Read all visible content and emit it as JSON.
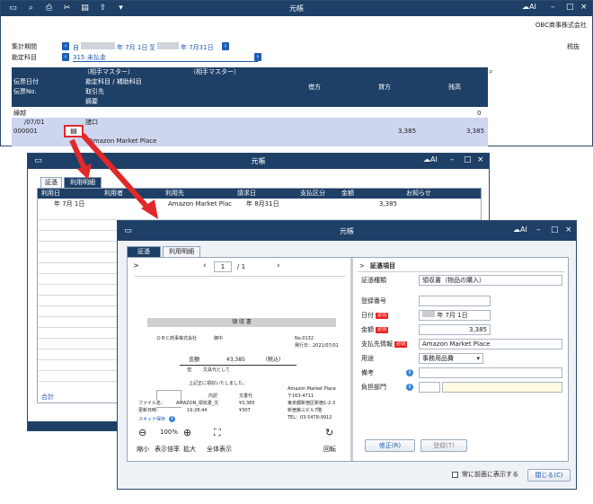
{
  "w1": {
    "title": "元帳",
    "company": "OBC商事株式会社",
    "period_label": "集計期間",
    "from": "自",
    "from_date": "年  7月 1日",
    "to": "至",
    "to_date": "年  7月31日",
    "account_label": "勘定科目",
    "account_code": "315",
    "account_name": "未払金",
    "tax": "税抜",
    "h_partner1": "（相手マスター）",
    "h_partner2": "（相手マスター）",
    "h_date": "伝票日付",
    "h_sub": "勘定科目 / 補助科目",
    "h_no": "伝票No.",
    "h_client": "取引先",
    "h_memo": "摘要",
    "h_debit": "借方",
    "h_credit": "貸方",
    "h_balance": "残高",
    "carry_label": "繰越",
    "carry_balance": "0",
    "r_date": "/07/01",
    "r_sub": "諸口",
    "r_no": "000001",
    "r_credit": "3,385",
    "r_balance": "3,385",
    "r_memo": "Amazon Market Place"
  },
  "w2": {
    "title": "元帳",
    "tab1": "証憑",
    "tab2": "利用明細",
    "cols": [
      "利用日",
      "利用者",
      "利用先",
      "請求日",
      "支払区分",
      "金額",
      "お知らせ"
    ],
    "r_date": "年  7月  1日",
    "r_dest": "Amazon Market Plac",
    "r_bill": "年  8月31日",
    "r_amt": "3,385",
    "total": "合計"
  },
  "w3": {
    "title": "元帳",
    "tab1": "証憑",
    "tab2": "利用明細",
    "page": "1",
    "pages": "/ 1",
    "section": "証憑項目",
    "type_label": "証憑種類",
    "type_value": "領収書（物品の購入）",
    "reg_label": "登録番号",
    "date_label": "日付",
    "date_value": "年  7月  1日",
    "amount_label": "金額",
    "amount_value": "3,385",
    "payee_label": "支払先情報",
    "payee_value": "Amazon Market Place",
    "use_label": "用途",
    "use_value": "事務用品費",
    "remark_label": "備考",
    "dept_label": "負担部門",
    "req": "必須",
    "zoom": "100%",
    "z_shrink": "縮小",
    "z_rate": "表示倍率",
    "z_expand": "拡大",
    "z_full": "全体表示",
    "z_rotate": "回転",
    "edit": "修正(R)",
    "register": "登録(T)",
    "front": "常に前面に表示する",
    "close": "閉じる(C)"
  },
  "receipt": {
    "title": "領 収 書",
    "company": "ＯＢＣ商事株式会社",
    "suffix": "御中",
    "no": "No.0132",
    "issued": "発行日：2021/07/01",
    "amount_label": "金額",
    "amount": "¥3,385",
    "tax_note": "（税込）",
    "for": "但",
    "item": "文具代として",
    "thanks": "上記正に領収いたしました。",
    "detail": "内訳",
    "tax_type": "文書代",
    "file_label": "ファイル名：",
    "file": "AMAZON_領収書_文",
    "upd_label": "更新日時：",
    "upd": "19:28:44",
    "net": "¥3,385",
    "tax": "¥307",
    "scan": "スキャナ保存",
    "shop": "Amazon Market Place",
    "zip": "〒163-4711",
    "addr1": "東京都新宿区新宿1-2-3",
    "addr2": "新宿第三ビル7階",
    "tel": "TEL：03-5478-9912"
  },
  "colors": {
    "navy": "#1e3f66",
    "accent": "#1d57a8",
    "arrow": "#e0292a",
    "row_highlight": "#cdd5ef"
  }
}
